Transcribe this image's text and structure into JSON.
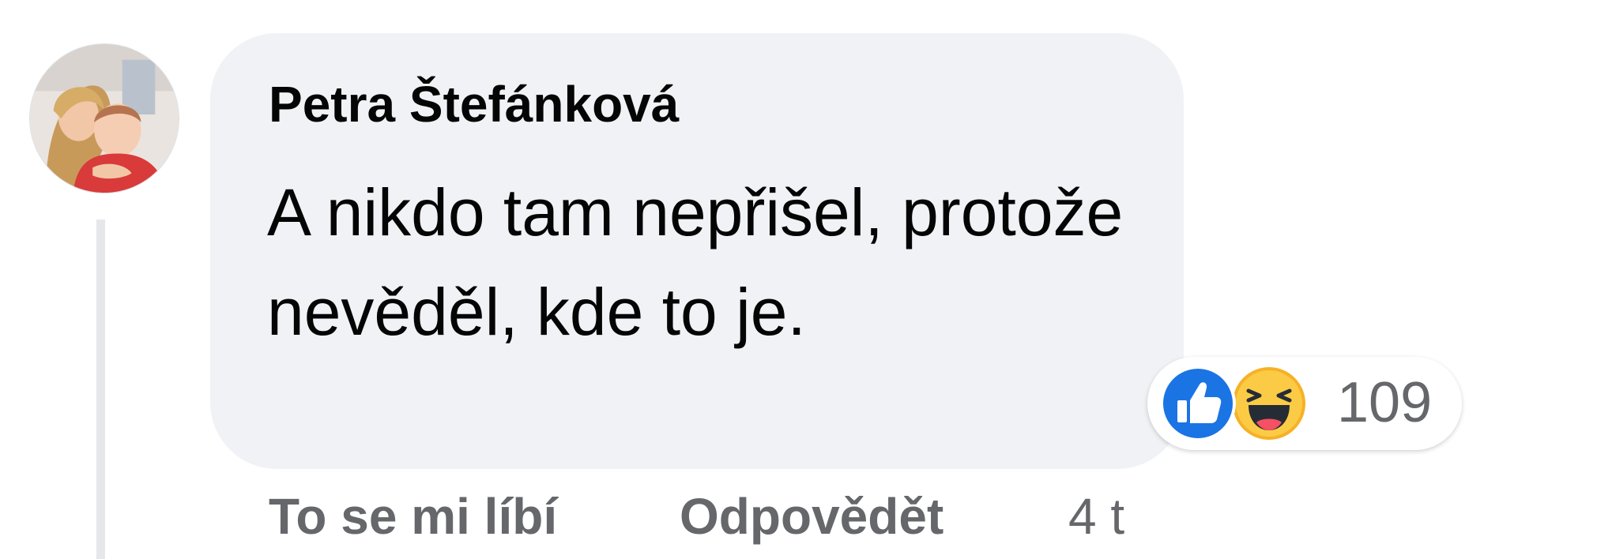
{
  "comment": {
    "author": "Petra Štefánková",
    "text": "A nikdo tam nepřišel, protože nevěděl, kde to je.",
    "avatar_icon": "user-avatar-photo"
  },
  "reactions": {
    "types": [
      "like-icon",
      "haha-icon"
    ],
    "count": "109",
    "colors": {
      "like": "#1b74e4",
      "haha": "#f7b125"
    }
  },
  "actions": {
    "like_label": "To se mi líbí",
    "reply_label": "Odpovědět",
    "timestamp": "4 t"
  },
  "colors": {
    "bubble": "#f0f2f5",
    "text": "#050505",
    "secondary": "#65676b",
    "thread_line": "#e6e7eb"
  }
}
